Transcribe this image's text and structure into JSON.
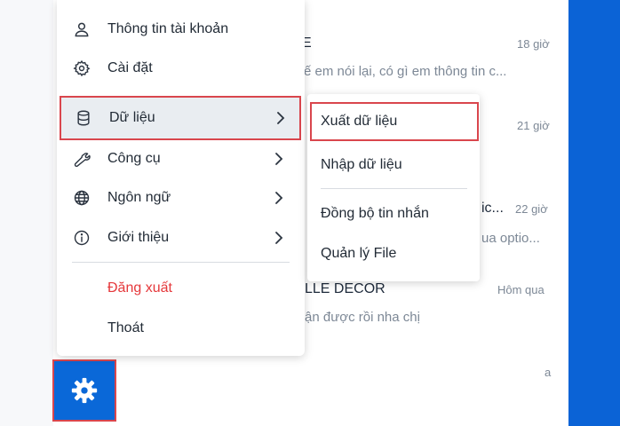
{
  "background_conversations": [
    {
      "name": "E",
      "time": "18 giờ",
      "snippet": "ế em nói lại, có gì em thông tin c..."
    },
    {
      "name": "",
      "time": "21 giờ",
      "snippet": ""
    },
    {
      "name": "ic...",
      "time": "22 giờ",
      "snippet": "ua optio..."
    },
    {
      "name": "LLE DECOR",
      "time": "Hôm qua",
      "snippet": "ận được rồi nha chị"
    },
    {
      "name": "",
      "time": "a",
      "snippet": ""
    }
  ],
  "main_menu": {
    "items": [
      {
        "label": "Thông tin tài khoản",
        "icon": "user-icon"
      },
      {
        "label": "Cài đặt",
        "icon": "gear-icon"
      },
      {
        "label": "Dữ liệu",
        "icon": "database-icon",
        "has_submenu": true,
        "highlighted": true
      },
      {
        "label": "Công cụ",
        "icon": "wrench-icon",
        "has_submenu": true
      },
      {
        "label": "Ngôn ngữ",
        "icon": "globe-icon",
        "has_submenu": true
      },
      {
        "label": "Giới thiệu",
        "icon": "info-icon",
        "has_submenu": true
      }
    ],
    "logout_label": "Đăng xuất",
    "exit_label": "Thoát"
  },
  "submenu": {
    "items": [
      {
        "label": "Xuất dữ liệu",
        "highlighted": true
      },
      {
        "label": "Nhập dữ liệu"
      },
      {
        "label": "Đồng bộ tin nhắn"
      },
      {
        "label": "Quản lý File"
      }
    ]
  },
  "settings_button": {
    "icon": "gear-icon"
  },
  "colors": {
    "accent_blue": "#0a68d8",
    "highlight_red": "#d9464d",
    "logout_red": "#e5383b",
    "menu_text": "#222b36",
    "muted_text": "#7d8896"
  }
}
